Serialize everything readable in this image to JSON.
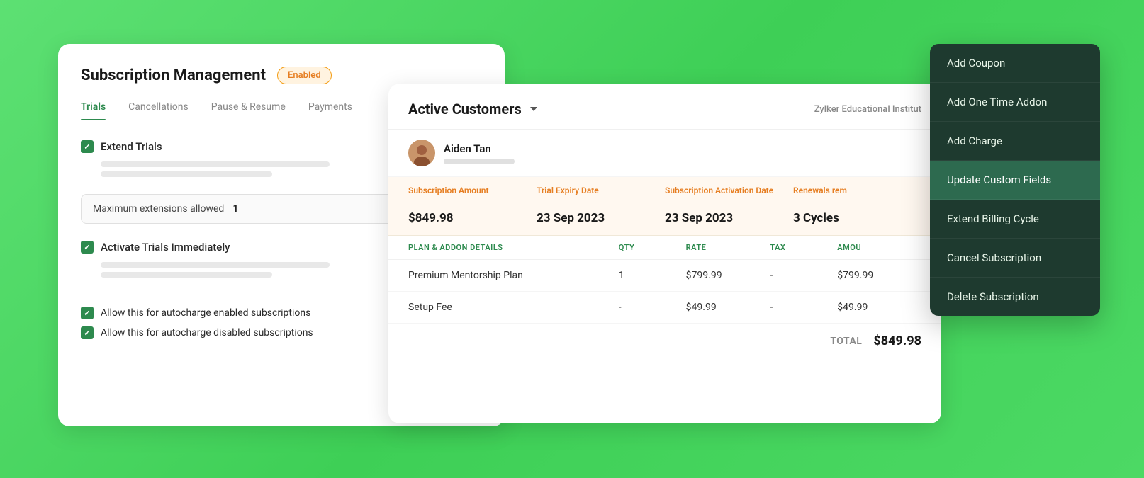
{
  "page": {
    "background_color": "#4cd964"
  },
  "left_card": {
    "title": "Subscription Management",
    "badge": "Enabled",
    "tabs": [
      {
        "label": "Trials",
        "active": true
      },
      {
        "label": "Cancellations",
        "active": false
      },
      {
        "label": "Pause & Resume",
        "active": false
      },
      {
        "label": "Payments",
        "active": false
      }
    ],
    "settings": {
      "extend_trials": {
        "label": "Extend Trials",
        "checked": true
      },
      "max_extensions": {
        "label": "Maximum extensions allowed",
        "value": "1"
      },
      "activate_trials": {
        "label": "Activate Trials Immediately",
        "checked": true
      },
      "autocharge_enabled": {
        "label": "Allow this for autocharge enabled subscriptions",
        "checked": true
      },
      "autocharge_disabled": {
        "label": "Allow this for autocharge disabled subscriptions",
        "checked": true
      }
    }
  },
  "right_card": {
    "title": "Active Customers",
    "institution": "Zylker Educational Institut",
    "customer": {
      "name": "Aiden Tan"
    },
    "subscription_columns": [
      "Subscription Amount",
      "Trial Expiry Date",
      "Subscription Activation Date",
      "Renewals rem"
    ],
    "subscription_values": [
      "$849.98",
      "23 Sep 2023",
      "23 Sep 2023",
      "3 Cycles"
    ],
    "plan_columns": [
      "PLAN & ADDON DETAILS",
      "QTY",
      "RATE",
      "TAX",
      "AMOU"
    ],
    "plan_rows": [
      {
        "name": "Premium Mentorship Plan",
        "qty": "1",
        "rate": "$799.99",
        "tax": "-",
        "amount": "$799.99"
      },
      {
        "name": "Setup Fee",
        "qty": "-",
        "rate": "$49.99",
        "tax": "-",
        "amount": "$49.99"
      }
    ],
    "total_label": "TOTAL",
    "total_value": "$849.98"
  },
  "dropdown": {
    "items": [
      {
        "label": "Add Coupon",
        "active": false
      },
      {
        "label": "Add One Time Addon",
        "active": false
      },
      {
        "label": "Add Charge",
        "active": false
      },
      {
        "label": "Update Custom Fields",
        "active": true
      },
      {
        "label": "Extend Billing Cycle",
        "active": false
      },
      {
        "label": "Cancel Subscription",
        "active": false
      },
      {
        "label": "Delete Subscription",
        "active": false
      }
    ]
  }
}
